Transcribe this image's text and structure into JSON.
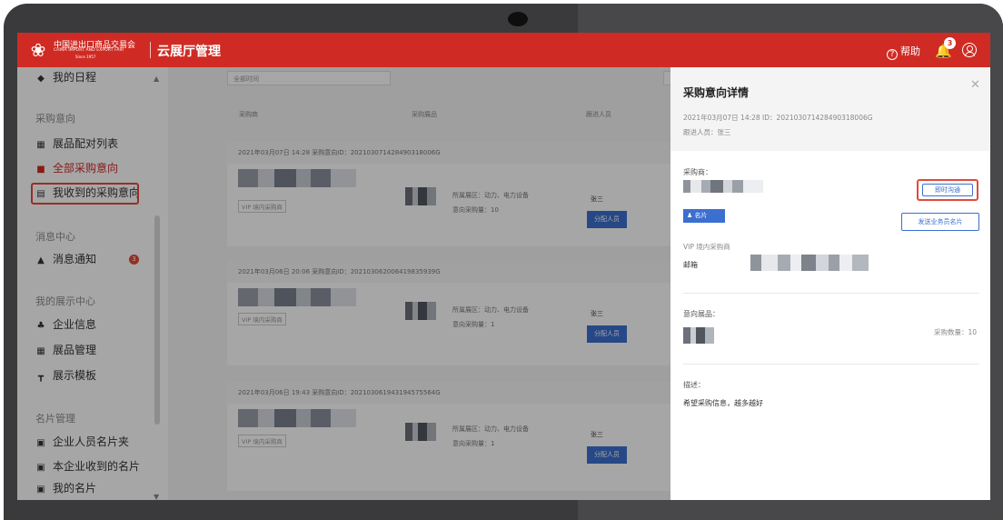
{
  "header": {
    "logo_cn": "中国进出口商品交易会",
    "logo_en": "CHINA IMPORT AND EXPORT FAIR",
    "logo_since": "Since 1957",
    "app_title": "云展厅管理",
    "help_label": "帮助",
    "notification_count": "3",
    "brand_color": "#cf2b24"
  },
  "sidebar": {
    "top_item": "我的日程",
    "sections": [
      {
        "title": "采购意向",
        "items": [
          "展品配对列表",
          "全部采购意向",
          "我收到的采购意向"
        ]
      },
      {
        "title": "消息中心",
        "items": [
          "消息通知"
        ]
      },
      {
        "title": "我的展示中心",
        "items": [
          "企业信息",
          "展品管理",
          "展示模板"
        ]
      },
      {
        "title": "名片管理",
        "items": [
          "企业人员名片夹",
          "本企业收到的名片",
          "我的名片"
        ]
      }
    ],
    "notice_badge": "3"
  },
  "main": {
    "filter_time": "全部时间",
    "columns": [
      "采购商",
      "采购展品",
      "跟进人员"
    ],
    "cards": [
      {
        "header": "2021年03月07日 14:28   采购意向ID：202103071428490318006G",
        "tag": "VIP 境内采购商",
        "area": "所属展区：动力、电力设备",
        "qty": "意向采购量：10",
        "follower": "张三",
        "assign": "分配人员"
      },
      {
        "header": "2021年03月06日 20:06   采购意向ID：202103062006419835939G",
        "tag": "VIP 境内采购商",
        "area": "所属展区：动力、电力设备",
        "qty": "意向采购量：1",
        "follower": "张三",
        "assign": "分配人员"
      },
      {
        "header": "2021年03月06日 19:43   采购意向ID：202103061943194575564G",
        "tag": "VIP 境内采购商",
        "area": "所属展区：动力、电力设备",
        "qty": "意向采购量：1",
        "follower": "张三",
        "assign": "分配人员"
      }
    ]
  },
  "drawer": {
    "title": "采购意向详情",
    "meta_line": "2021年03月07日 14:28   ID：202103071428490318006G",
    "follower_line": "跟进人员：张三",
    "buyer_label": "采购商：",
    "chat_button": "即时沟通",
    "card_tag": "名片",
    "send_card_button": "发送业务员名片",
    "buyer_type": "VIP 境内采购商",
    "email_label": "邮箱",
    "product_label": "意向展品：",
    "purchase_qty": "采购数量：10",
    "desc_label": "描述：",
    "desc_text": "希望采购信息，越多越好"
  }
}
